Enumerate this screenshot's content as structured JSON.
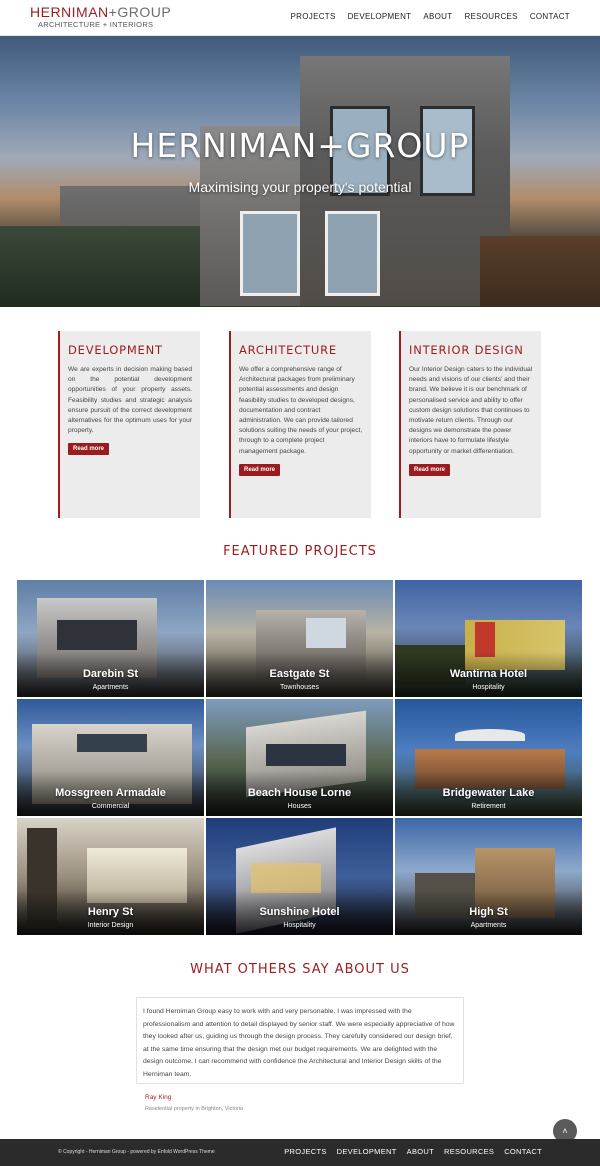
{
  "header": {
    "logo_main_left": "HERNIMAN",
    "logo_main_right": "+GROUP",
    "logo_sub": "ARCHITECTURE + INTERIORS",
    "nav": [
      "PROJECTS",
      "DEVELOPMENT",
      "ABOUT",
      "RESOURCES",
      "CONTACT"
    ]
  },
  "hero": {
    "title": "HERNIMAN+GROUP",
    "subtitle": "Maximising your property's potential"
  },
  "services": [
    {
      "title": "DEVELOPMENT",
      "text": "We are experts in decision making based on the potential development opportunities of your property assets. Feasibility studies and strategic analysis ensure pursuit of the correct development alternatives for the optimum uses for your property.",
      "button": "Read more"
    },
    {
      "title": "ARCHITECTURE",
      "text": "We offer a comprehensive range of Architectural packages from preliminary potential assessments and design feasibility studies to developed designs, documentation and contract administration. We can provide tailored solutions suiting the needs of your project, through to a complete project management package.",
      "button": "Read more"
    },
    {
      "title": "INTERIOR DESIGN",
      "text": "Our Interior Design caters to the individual needs and visions of our clients' and their brand. We believe it is our benchmark of personalised service and ability to offer custom design solutions that continues to motivate return clients. Through our designs we demonstrate the power interiors have to formulate lifestyle opportunity or market differentiation.",
      "button": "Read more"
    }
  ],
  "featured": {
    "title": "FEATURED PROJECTS",
    "projects": [
      {
        "name": "Darebin St",
        "category": "Apartments"
      },
      {
        "name": "Eastgate St",
        "category": "Townhouses"
      },
      {
        "name": "Wantirna Hotel",
        "category": "Hospitality"
      },
      {
        "name": "Mossgreen Armadale",
        "category": "Commercial"
      },
      {
        "name": "Beach House Lorne",
        "category": "Houses"
      },
      {
        "name": "Bridgewater Lake",
        "category": "Retirement"
      },
      {
        "name": "Henry St",
        "category": "Interior Design"
      },
      {
        "name": "Sunshine Hotel",
        "category": "Hospitality"
      },
      {
        "name": "High St",
        "category": "Apartments"
      }
    ]
  },
  "testimonials": {
    "title": "WHAT OTHERS SAY ABOUT US",
    "quote": "I found Herniman Group  easy to work with and very personable. I was impressed with the professionalism and attention to detail displayed by senior staff. We were especially appreciative of how they looked after us, guiding us through the design process. They carefully considered our design brief, at the same time ensuring that the design met our budget requirements. We are delighted with the design outcome. I can recommend with confidence the Architectural and Interior Design skills of the Herniman team.",
    "author": "Ray King",
    "role": "Residential property in Brighton, Victoria"
  },
  "footer": {
    "copyright": "© Copyright - Herniman Group - powered by Enfold WordPress Theme",
    "nav": [
      "PROJECTS",
      "DEVELOPMENT",
      "ABOUT",
      "RESOURCES",
      "CONTACT"
    ],
    "to_top": "˄"
  },
  "colors": {
    "accent": "#9b1c1f",
    "footer_bg": "#2b2b2b",
    "box_bg": "#ececec"
  }
}
